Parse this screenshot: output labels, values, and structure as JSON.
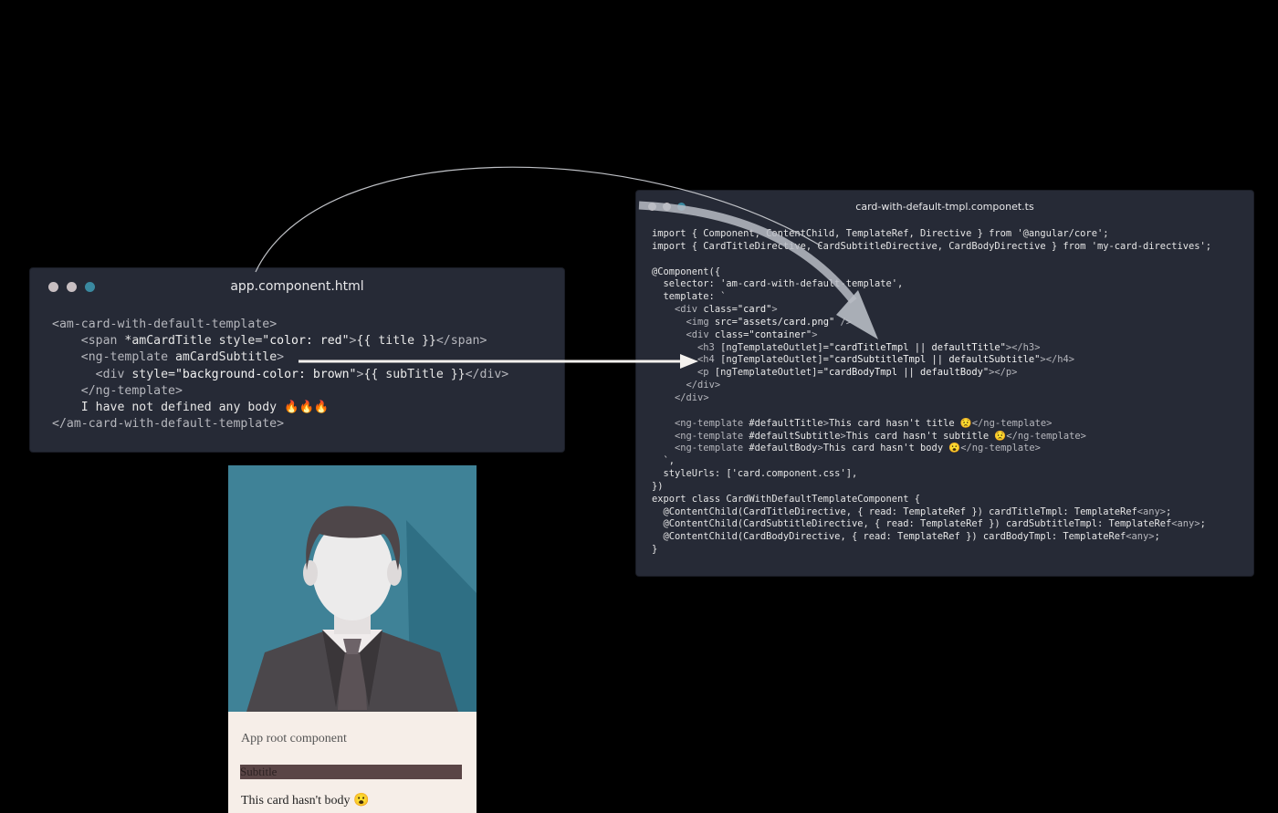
{
  "windows": {
    "left": {
      "title": "app.component.html",
      "lines": [
        "<am-card-with-default-template>",
        "    <span *amCardTitle style=\"color: red\">{{ title }}</span>",
        "    <ng-template amCardSubtitle>",
        "      <div style=\"background-color: brown\">{{ subTitle }}</div>",
        "    </ng-template>",
        "    I have not defined any body 🔥🔥🔥",
        "</am-card-with-default-template>"
      ]
    },
    "right": {
      "title": "card-with-default-tmpl.componet.ts",
      "lines": [
        "import { Component, ContentChild, TemplateRef, Directive } from '@angular/core';",
        "import { CardTitleDirective, CardSubtitleDirective, CardBodyDirective } from 'my-card-directives';",
        "",
        "@Component({",
        "  selector: 'am-card-with-default-template',",
        "  template: `",
        "    <div class=\"card\">",
        "      <img src=\"assets/card.png\" />",
        "      <div class=\"container\">",
        "        <h3 [ngTemplateOutlet]=\"cardTitleTmpl || defaultTitle\"></h3>",
        "        <h4 [ngTemplateOutlet]=\"cardSubtitleTmpl || defaultSubtitle\"></h4>",
        "        <p [ngTemplateOutlet]=\"cardBodyTmpl || defaultBody\"></p>",
        "      </div>",
        "    </div>",
        "",
        "    <ng-template #defaultTitle>This card hasn't title 😟</ng-template>",
        "    <ng-template #defaultSubtitle>This card hasn't subtitle 😟</ng-template>",
        "    <ng-template #defaultBody>This card hasn't body 😮</ng-template>",
        "  `,",
        "  styleUrls: ['card.component.css'],",
        "})",
        "export class CardWithDefaultTemplateComponent {",
        "  @ContentChild(CardTitleDirective, { read: TemplateRef }) cardTitleTmpl: TemplateRef<any>;",
        "  @ContentChild(CardSubtitleDirective, { read: TemplateRef }) cardSubtitleTmpl: TemplateRef<any>;",
        "  @ContentChild(CardBodyDirective, { read: TemplateRef }) cardBodyTmpl: TemplateRef<any>;",
        "}"
      ]
    }
  },
  "card": {
    "title": "App root component",
    "subtitle": "Subtitle",
    "body": "This card hasn't body 😮"
  },
  "colors": {
    "window_bg": "#262a36",
    "dot_1": "#c8bfc2",
    "dot_2": "#c8bfc2",
    "dot_3": "#3a89a0",
    "card_bg": "#f6eee8",
    "subtitle_bg": "#5a4546",
    "image_bg": "#3f8297"
  },
  "icons": [
    "window-dots-icon",
    "avatar-illustration-icon",
    "arrow-icon"
  ]
}
